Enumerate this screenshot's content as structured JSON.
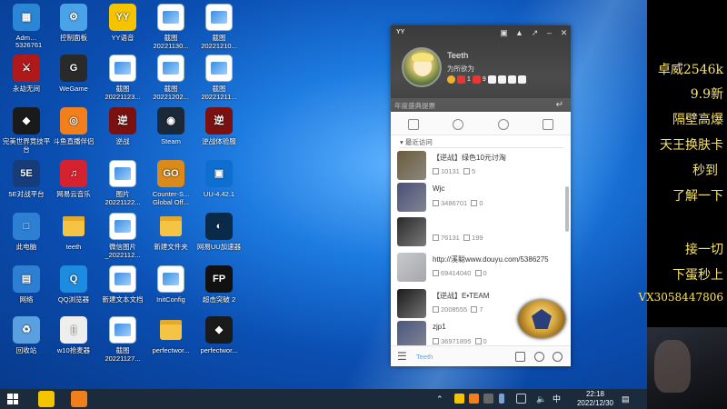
{
  "desktop": {
    "icons": [
      {
        "id": "admin",
        "label": "Adm…",
        "color": "#2b86d6",
        "glyph": "▦"
      },
      {
        "id": "control",
        "label": "控制面板",
        "color": "#4aa3e6",
        "glyph": "⚙"
      },
      {
        "id": "yy",
        "label": "YY语音",
        "color": "#f4c400",
        "glyph": "YY"
      },
      {
        "id": "shot1",
        "label": "截图\n20221130...",
        "type": "doc"
      },
      {
        "id": "shot2",
        "label": "截图\n20221210...",
        "type": "doc"
      },
      {
        "id": "naraka",
        "label": "永劫无间",
        "color": "#b01919",
        "glyph": "⚔"
      },
      {
        "id": "wegame",
        "label": "WeGame",
        "color": "#2a2a2a",
        "glyph": "G"
      },
      {
        "id": "shot3",
        "label": "截图\n20221123...",
        "type": "doc"
      },
      {
        "id": "shot4",
        "label": "截图\n20221202...",
        "type": "doc"
      },
      {
        "id": "shot5",
        "label": "截图\n20221211...",
        "type": "doc"
      },
      {
        "id": "wanmei",
        "label": "完美世界竞技平台",
        "color": "#1a1a1a",
        "glyph": "◆"
      },
      {
        "id": "douyu",
        "label": "斗鱼直播伴侣",
        "color": "#f07f1c",
        "glyph": "◎"
      },
      {
        "id": "nizhan",
        "label": "逆战",
        "color": "#7a1010",
        "glyph": "逆"
      },
      {
        "id": "steam",
        "label": "Steam",
        "color": "#1b2838",
        "glyph": "◉"
      },
      {
        "id": "nizhan2",
        "label": "逆战体验服",
        "color": "#7a1010",
        "glyph": "逆"
      },
      {
        "id": "5e",
        "label": "5E对战平台",
        "color": "#163d7a",
        "glyph": "5E"
      },
      {
        "id": "netease",
        "label": "网易云音乐",
        "color": "#d6212e",
        "glyph": "♫"
      },
      {
        "id": "pic",
        "label": "图片\n20221122...",
        "type": "doc"
      },
      {
        "id": "csgo",
        "label": "Counter-S...\nGlobal Off...",
        "color": "#d98a1a",
        "glyph": "GO"
      },
      {
        "id": "uu",
        "label": "UU-4.42.1",
        "color": "#0f6fd0",
        "glyph": "▣"
      },
      {
        "id": "pc",
        "label": "此电脑",
        "color": "#2d7fd3",
        "glyph": "□"
      },
      {
        "id": "teeth",
        "label": "teeth",
        "type": "folder"
      },
      {
        "id": "wechatpic",
        "label": "微信图片\n_2022112...",
        "type": "doc"
      },
      {
        "id": "newfolder",
        "label": "新建文件夹",
        "type": "folder"
      },
      {
        "id": "uuacc",
        "label": "网易UU加速器",
        "color": "#0a2a4a",
        "glyph": "◐"
      },
      {
        "id": "network",
        "label": "网络",
        "color": "#2d7fd3",
        "glyph": "▤"
      },
      {
        "id": "qqbrowser",
        "label": "QQ浏览器",
        "color": "#1d8ce0",
        "glyph": "Q"
      },
      {
        "id": "newtxt",
        "label": "新建文本文档",
        "type": "doc"
      },
      {
        "id": "initconfig",
        "label": "InitConfig",
        "type": "doc"
      },
      {
        "id": "breakthrough",
        "label": "超击突破 2",
        "color": "#111111",
        "glyph": "FP"
      },
      {
        "id": "recycle",
        "label": "回收站",
        "color": "#5aa0e0",
        "glyph": "♻"
      },
      {
        "id": "w10",
        "label": "w10抢麦器",
        "color": "#eeeeee",
        "glyph": "▯"
      },
      {
        "id": "shot6",
        "label": "截图\n20221127...",
        "type": "doc"
      },
      {
        "id": "pw1",
        "label": "perfectwor...",
        "type": "folder"
      },
      {
        "id": "pw2",
        "label": "perfectwor...",
        "color": "#1a1a1a",
        "glyph": "◆"
      }
    ],
    "badge_number": "5326761"
  },
  "chat_window": {
    "title_logo": "YY",
    "profile_name": "Teeth",
    "profile_status": "为所欲为",
    "badge_counts": [
      "1",
      "9"
    ],
    "search_placeholder": "年度盛典提票",
    "recent_header": "最近访问",
    "rows": [
      {
        "name": "【逆战】绿色10元讨淘",
        "viewers": "10131",
        "count": "5",
        "thumb": "#6a5b3c"
      },
      {
        "name": "Wjc",
        "viewers": "3486701",
        "count": "0",
        "thumb": "#48507a"
      },
      {
        "name": "",
        "viewers": "76131",
        "count": "199",
        "thumb": "#2a2a2a"
      },
      {
        "name": "http://溪聪www.douyu.com/5386275",
        "viewers": "69414040",
        "count": "0",
        "thumb": "#c6c9cf"
      },
      {
        "name": "【逆战】E•TEAM",
        "viewers": "2008555",
        "count": "7",
        "thumb": "#1a1a1a"
      },
      {
        "name": "zjp1",
        "viewers": "36971895",
        "count": "0",
        "thumb": "#4a5680"
      }
    ],
    "footer_label": "Teeth"
  },
  "taskbar": {
    "time": "22:18",
    "date": "2022/12/30",
    "ime": "中"
  },
  "stream_panel": {
    "lines": [
      "卓威2546k",
      "9.9新",
      "隔壁高爆",
      "天王换肤卡",
      "秒到",
      "了解一下",
      "接一切",
      "下蛋秒上",
      "VX3058447806"
    ]
  },
  "colors": {
    "accent": "#f7e36a",
    "taskbar": "#1c2b3c"
  }
}
